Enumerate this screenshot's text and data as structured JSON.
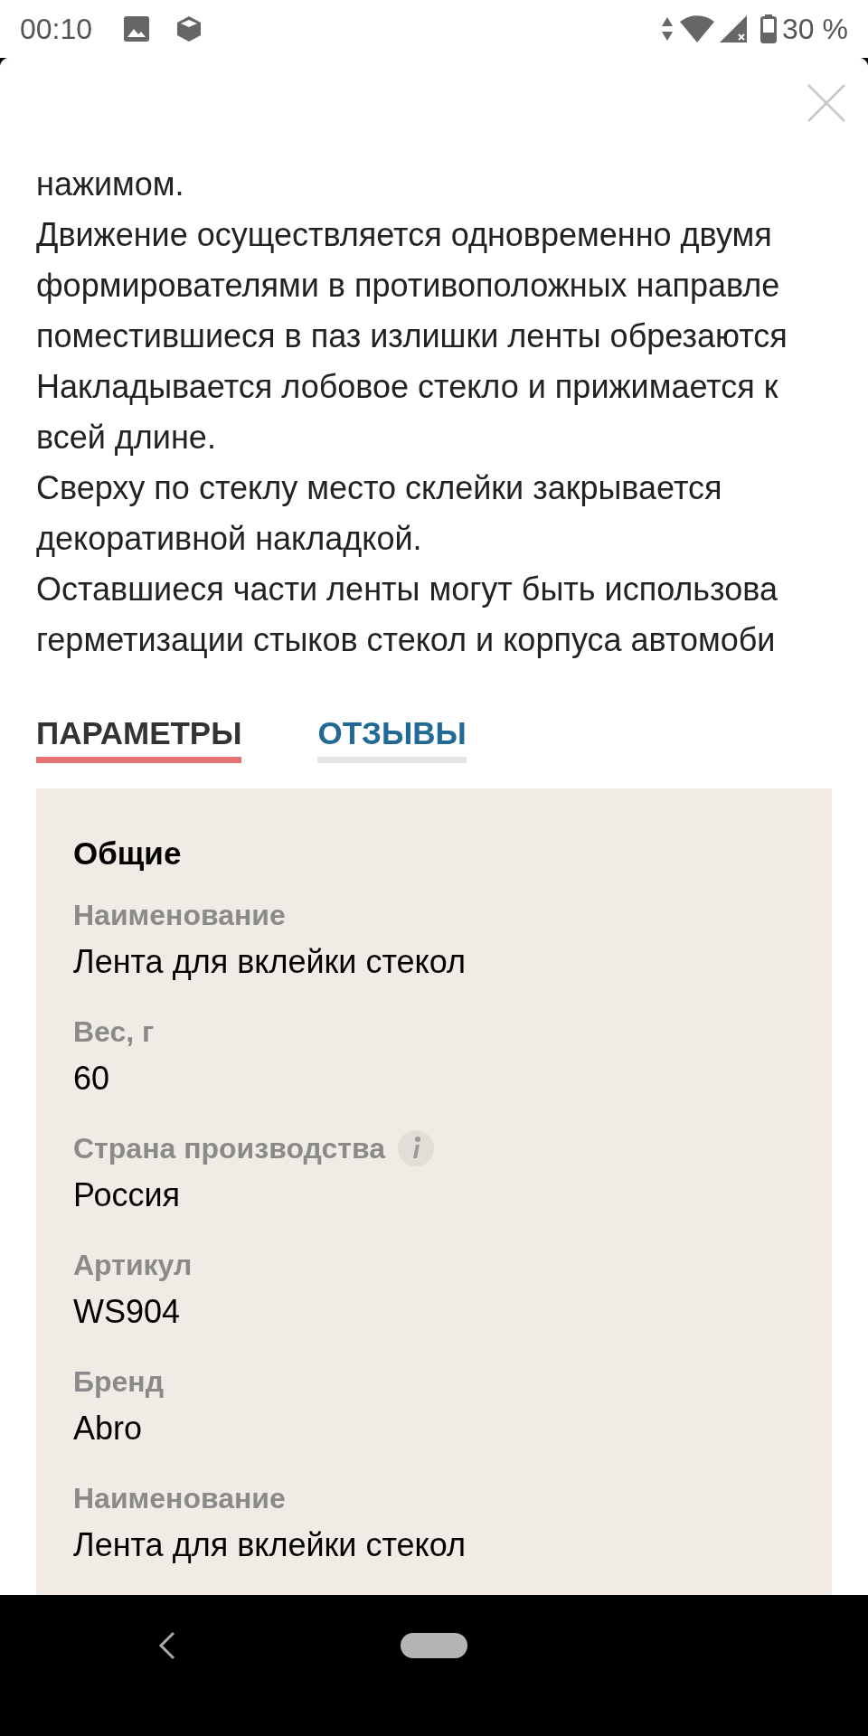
{
  "status_bar": {
    "time": "00:10",
    "battery": "30 %"
  },
  "description": [
    "нажимом.",
    "Движение осуществляется одновременно двумя",
    "формирователями в противоположных направле",
    "поместившиеся в паз излишки ленты обрезаются",
    "Накладывается лобовое стекло и прижимается к",
    "всей длине.",
    "Сверху по стеклу место склейки закрывается",
    "декоративной накладкой.",
    "Оставшиеся части ленты могут быть использова",
    "герметизации стыков стекол и корпуса автомоби"
  ],
  "tabs": [
    {
      "label": "ПАРАМЕТРЫ",
      "selected": true
    },
    {
      "label": "ОТЗЫВЫ",
      "selected": false
    }
  ],
  "params": {
    "section": "Общие",
    "rows": [
      {
        "label": "Наименование",
        "value": "Лента для вклейки стекол",
        "info": false
      },
      {
        "label": "Вес, г",
        "value": "60",
        "info": false
      },
      {
        "label": "Страна производства",
        "value": "Россия",
        "info": true
      },
      {
        "label": "Артикул",
        "value": "WS904",
        "info": false
      },
      {
        "label": "Бренд",
        "value": "Abro",
        "info": false
      },
      {
        "label": "Наименование",
        "value": "Лента для вклейки стекол",
        "info": false
      }
    ]
  }
}
